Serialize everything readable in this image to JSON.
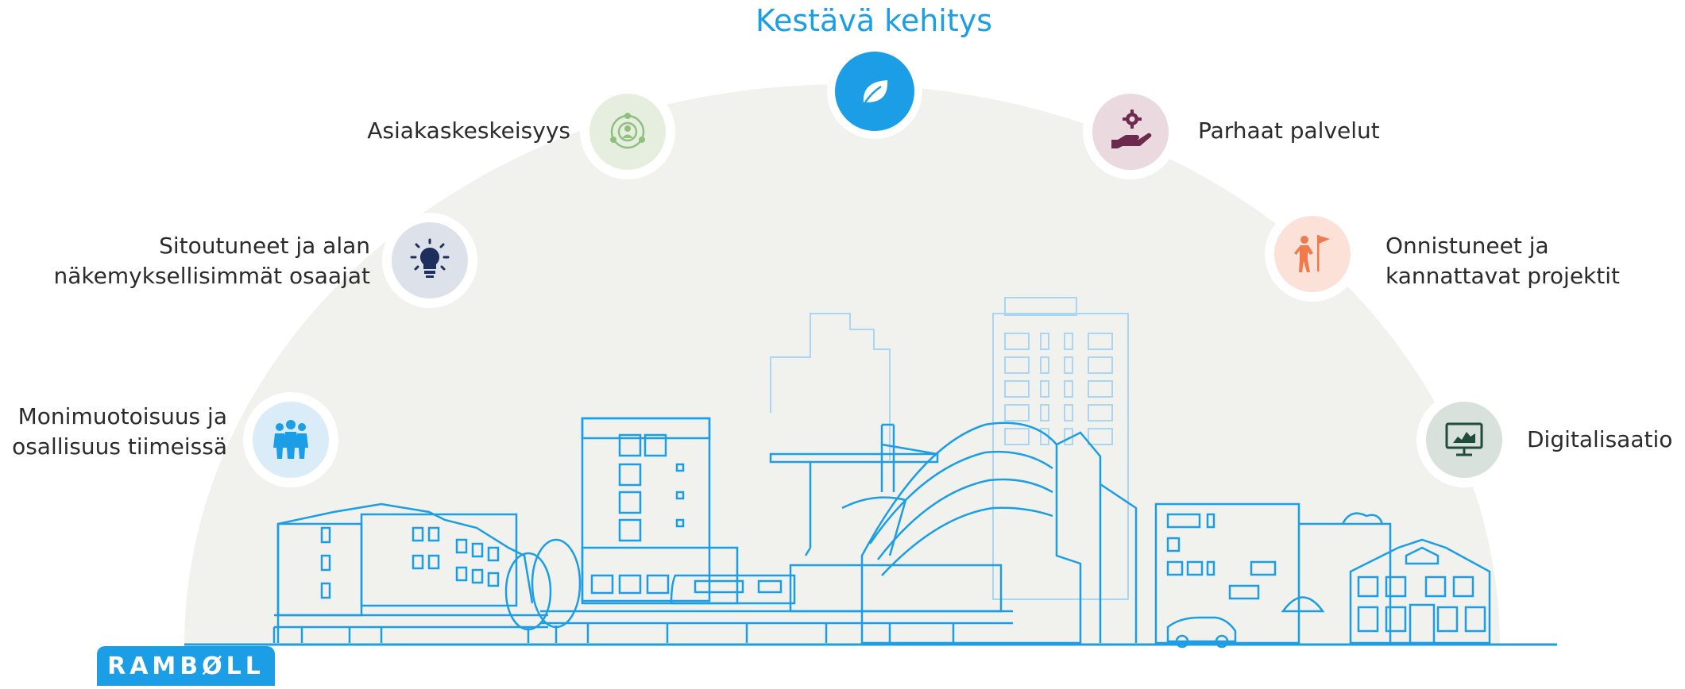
{
  "title": "Kestävä kehitys",
  "values": [
    {
      "label_lines": [
        "Monimuotoisuus ja",
        "osallisuus tiimeissä"
      ],
      "icon": "people-group-icon",
      "color": "#1b9ee6",
      "bg": "#d9ecf8"
    },
    {
      "label_lines": [
        "Sitoutuneet ja alan",
        "näkemyksellisimmät osaajat"
      ],
      "icon": "lightbulb-icon",
      "color": "#1d2f5c",
      "bg": "#dde1ea"
    },
    {
      "label_lines": [
        "Asiakaskeskeisyys"
      ],
      "icon": "customer-focus-icon",
      "color": "#8fc07e",
      "bg": "#e6efdf"
    },
    {
      "label_lines": [
        "Kestävä kehitys"
      ],
      "icon": "leaf-icon",
      "color": "#ffffff",
      "bg": "#1b9ee6"
    },
    {
      "label_lines": [
        "Parhaat palvelut"
      ],
      "icon": "hand-gear-icon",
      "color": "#6b2a4e",
      "bg": "#ead9df"
    },
    {
      "label_lines": [
        "Onnistuneet ja",
        "kannattavat projektit"
      ],
      "icon": "person-flag-icon",
      "color": "#ef7a4a",
      "bg": "#fbe1d7"
    },
    {
      "label_lines": [
        "Digitalisaatio"
      ],
      "icon": "digital-screen-icon",
      "color": "#1f4d3a",
      "bg": "#d8e1dc"
    }
  ],
  "logo_text": "RAMBØLL",
  "colors": {
    "accent": "#1b9ee6",
    "dome": "#f2f2ef",
    "line": "#1b9ee6",
    "line_light": "#a9d6f2"
  }
}
